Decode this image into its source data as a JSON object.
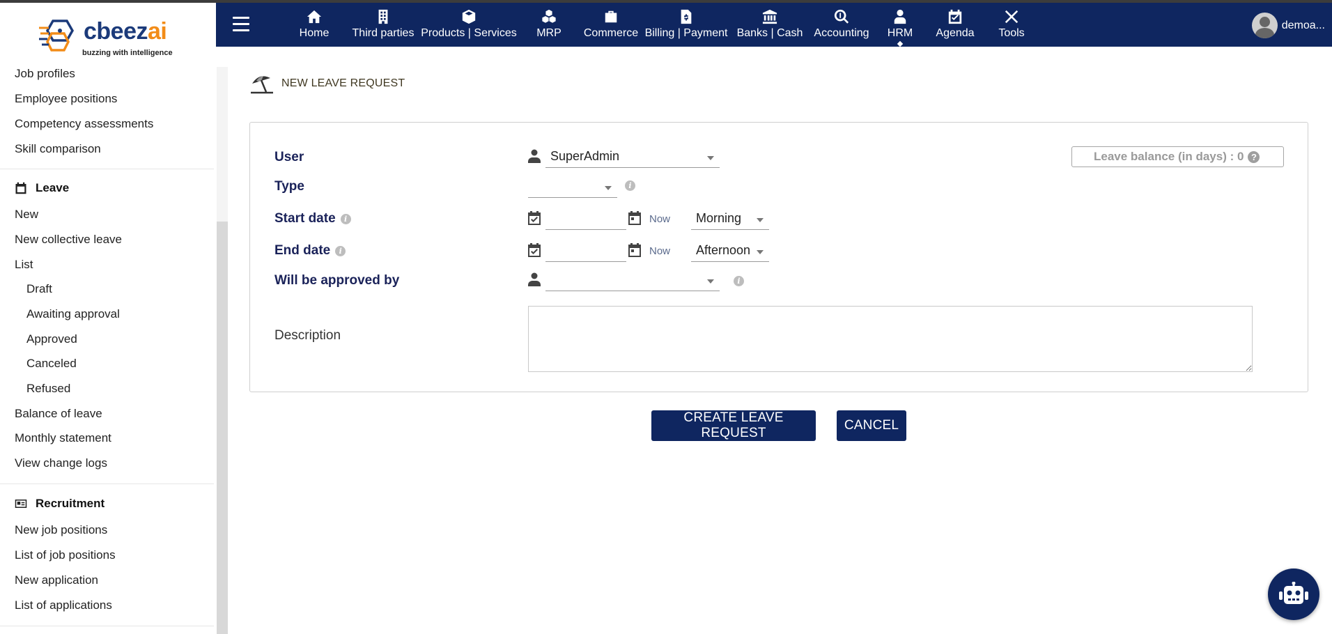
{
  "brand": {
    "name_main": "cbeez",
    "name_accent": "ai",
    "tagline": "buzzing with intelligence",
    "accent_color": "#f28c18",
    "brand_color": "#1b3a7a"
  },
  "navbar": {
    "background": "#0f2660",
    "items": [
      {
        "label": "Home",
        "icon": "home-icon"
      },
      {
        "label": "Third parties",
        "icon": "building-icon"
      },
      {
        "label": "Products | Services",
        "icon": "cube-icon"
      },
      {
        "label": "MRP",
        "icon": "cubes-icon"
      },
      {
        "label": "Commerce",
        "icon": "suitcase-icon"
      },
      {
        "label": "Billing | Payment",
        "icon": "invoice-icon"
      },
      {
        "label": "Banks | Cash",
        "icon": "bank-icon"
      },
      {
        "label": "Accounting",
        "icon": "search-dollar-icon"
      },
      {
        "label": "HRM",
        "icon": "user-tie-icon"
      },
      {
        "label": "Agenda",
        "icon": "calendar-check-icon"
      },
      {
        "label": "Tools",
        "icon": "tools-icon"
      }
    ],
    "active": "HRM",
    "user": "demoa..."
  },
  "sidebar": {
    "top_items": [
      "Job profiles",
      "Employee positions",
      "Competency assessments",
      "Skill comparison"
    ],
    "leave": {
      "heading": "Leave",
      "items": [
        "New",
        "New collective leave",
        "List"
      ],
      "list_sub": [
        "Draft",
        "Awaiting approval",
        "Approved",
        "Canceled",
        "Refused"
      ],
      "more": [
        "Balance of leave",
        "Monthly statement",
        "View change logs"
      ]
    },
    "recruitment": {
      "heading": "Recruitment",
      "items": [
        "New job positions",
        "List of job positions",
        "New application",
        "List of applications"
      ]
    }
  },
  "page": {
    "title": "NEW LEAVE REQUEST"
  },
  "form": {
    "user_label": "User",
    "user_value": "SuperAdmin",
    "type_label": "Type",
    "type_value": "",
    "start_label": "Start date",
    "start_value": "",
    "start_now": "Now",
    "start_period": "Morning",
    "end_label": "End date",
    "end_value": "",
    "end_now": "Now",
    "end_period": "Afternoon",
    "approver_label": "Will be approved by",
    "approver_value": "",
    "description_label": "Description",
    "description_value": "",
    "balance_text": "Leave balance (in days) : 0"
  },
  "actions": {
    "create": "CREATE LEAVE REQUEST",
    "cancel": "CANCEL"
  }
}
